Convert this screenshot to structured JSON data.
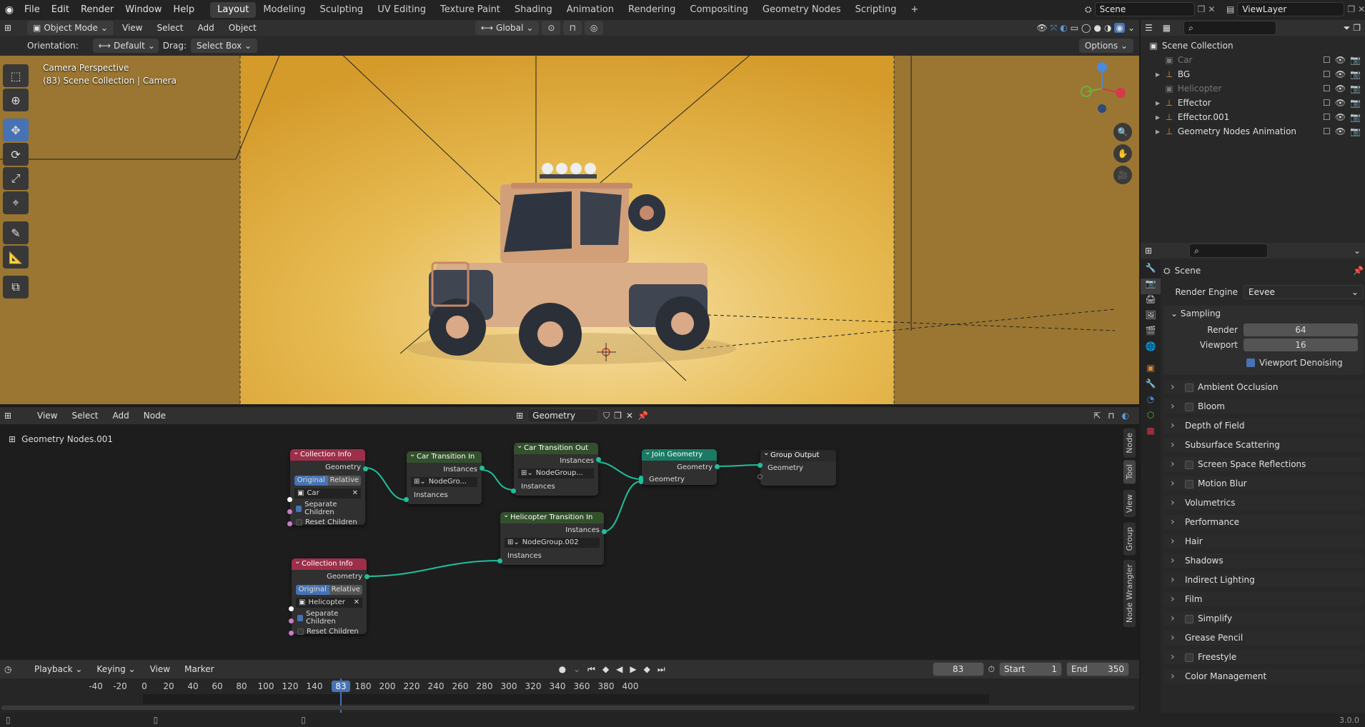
{
  "menubar": {
    "items": [
      "File",
      "Edit",
      "Render",
      "Window",
      "Help"
    ],
    "workspaces": [
      "Layout",
      "Modeling",
      "Sculpting",
      "UV Editing",
      "Texture Paint",
      "Shading",
      "Animation",
      "Rendering",
      "Compositing",
      "Geometry Nodes",
      "Scripting"
    ],
    "active_workspace": "Layout",
    "add_tab": "+",
    "scene_name": "Scene",
    "view_layer": "ViewLayer"
  },
  "viewport_header": {
    "mode": "Object Mode",
    "menus": [
      "View",
      "Select",
      "Add",
      "Object"
    ],
    "transform": "Global",
    "orientation_label": "Orientation:",
    "orientation_value": "Default",
    "drag_label": "Drag:",
    "drag_value": "Select Box",
    "options": "Options"
  },
  "viewport": {
    "perspective": "Camera Perspective",
    "collection": "(83) Scene Collection | Camera",
    "background_color": "#e3b548"
  },
  "outliner": {
    "root": "Scene Collection",
    "items": [
      {
        "name": "Car",
        "dim": true,
        "expander": false
      },
      {
        "name": "BG",
        "dim": false,
        "expander": true
      },
      {
        "name": "Helicopter",
        "dim": true,
        "expander": false
      },
      {
        "name": "Effector",
        "dim": false,
        "expander": true
      },
      {
        "name": "Effector.001",
        "dim": false,
        "expander": true
      },
      {
        "name": "Geometry Nodes Animation",
        "dim": false,
        "expander": true
      }
    ]
  },
  "properties": {
    "context": "Scene",
    "render_engine_label": "Render Engine",
    "render_engine": "Eevee",
    "sampling": "Sampling",
    "render_label": "Render",
    "render_value": "64",
    "viewport_label": "Viewport",
    "viewport_value": "16",
    "denoise": "Viewport Denoising",
    "panels": [
      {
        "label": "Ambient Occlusion",
        "checkbox": true
      },
      {
        "label": "Bloom",
        "checkbox": true
      },
      {
        "label": "Depth of Field",
        "checkbox": false
      },
      {
        "label": "Subsurface Scattering",
        "checkbox": false
      },
      {
        "label": "Screen Space Reflections",
        "checkbox": true
      },
      {
        "label": "Motion Blur",
        "checkbox": true
      },
      {
        "label": "Volumetrics",
        "checkbox": false
      },
      {
        "label": "Performance",
        "checkbox": false
      },
      {
        "label": "Hair",
        "checkbox": false
      },
      {
        "label": "Shadows",
        "checkbox": false
      },
      {
        "label": "Indirect Lighting",
        "checkbox": false
      },
      {
        "label": "Film",
        "checkbox": false
      },
      {
        "label": "Simplify",
        "checkbox": true
      },
      {
        "label": "Grease Pencil",
        "checkbox": false
      },
      {
        "label": "Freestyle",
        "checkbox": true
      },
      {
        "label": "Color Management",
        "checkbox": false
      }
    ]
  },
  "node_editor": {
    "menus": [
      "View",
      "Select",
      "Add",
      "Node"
    ],
    "tree_name": "Geometry Nodes.001",
    "breadcrumb": "Geometry Nodes.001",
    "side_tabs": [
      "Node",
      "Tool",
      "View",
      "Group",
      "Node Wrangler"
    ],
    "nodes": {
      "ci1": {
        "title": "Collection Info",
        "out": "Geometry",
        "original": "Original",
        "relative": "Relative",
        "collection": "Car",
        "sep": "Separate Children",
        "reset": "Reset Children"
      },
      "ci2": {
        "title": "Collection Info",
        "out": "Geometry",
        "original": "Original",
        "relative": "Relative",
        "collection": "Helicopter",
        "sep": "Separate Children",
        "reset": "Reset Children"
      },
      "cti": {
        "title": "Car Transition In",
        "out": "Instances",
        "group": "NodeGro...",
        "in": "Instances"
      },
      "cto": {
        "title": "Car Transition Out",
        "out": "Instances",
        "group": "NodeGroup...",
        "in": "Instances"
      },
      "hti": {
        "title": "Helicopter Transition In",
        "out": "Instances",
        "group": "NodeGroup.002",
        "in": "Instances"
      },
      "jg": {
        "title": "Join Geometry",
        "out": "Geometry",
        "in": "Geometry"
      },
      "go": {
        "title": "Group Output",
        "in": "Geometry"
      }
    }
  },
  "timeline": {
    "menus": [
      "Playback",
      "Keying",
      "View",
      "Marker"
    ],
    "current_frame": "83",
    "start_label": "Start",
    "start": "1",
    "end_label": "End",
    "end": "350",
    "ticks": [
      "-40",
      "-20",
      "0",
      "20",
      "40",
      "60",
      "80",
      "100",
      "120",
      "140",
      "160",
      "180",
      "200",
      "220",
      "240",
      "260",
      "280",
      "300",
      "320",
      "340",
      "360",
      "380",
      "400"
    ],
    "playhead": "83"
  },
  "statusbar": {
    "version": "3.0.0"
  }
}
